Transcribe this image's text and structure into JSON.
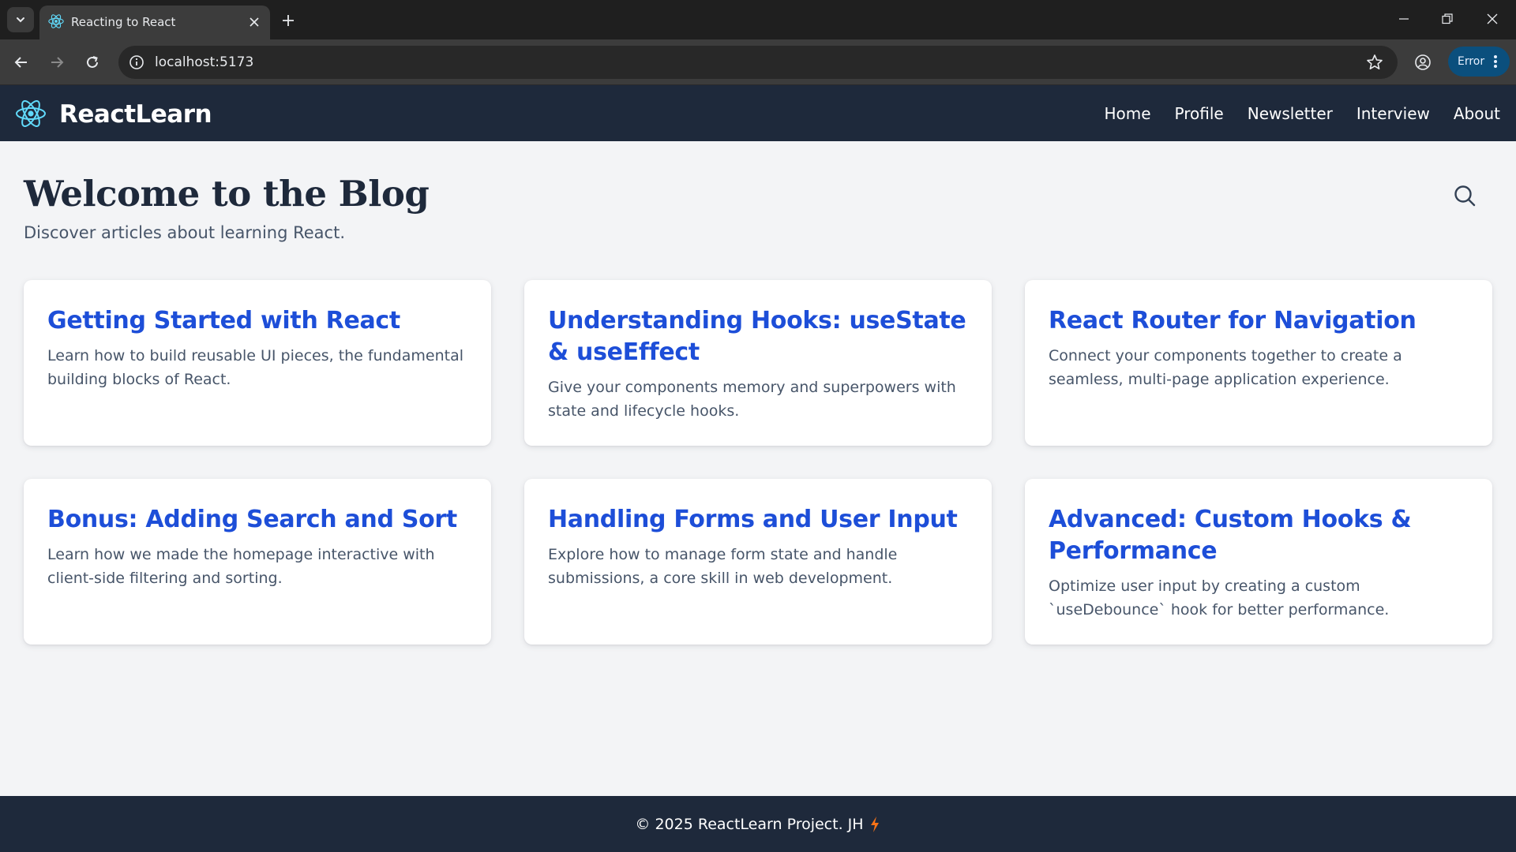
{
  "browser": {
    "tab_title": "Reacting to React",
    "url": "localhost:5173",
    "error_label": "Error"
  },
  "header": {
    "brand": "ReactLearn",
    "nav": [
      {
        "label": "Home"
      },
      {
        "label": "Profile"
      },
      {
        "label": "Newsletter"
      },
      {
        "label": "Interview"
      },
      {
        "label": "About"
      }
    ]
  },
  "main": {
    "title": "Welcome to the Blog",
    "subtitle": "Discover articles about learning React.",
    "search_icon": "search-icon",
    "posts": [
      {
        "title": "Getting Started with React",
        "description": "Learn how to build reusable UI pieces, the fundamental building blocks of React."
      },
      {
        "title": "Understanding Hooks: useState & useEffect",
        "description": "Give your components memory and superpowers with state and lifecycle hooks."
      },
      {
        "title": "React Router for Navigation",
        "description": "Connect your components together to create a seamless, multi-page application experience."
      },
      {
        "title": "Bonus: Adding Search and Sort",
        "description": "Learn how we made the homepage interactive with client-side filtering and sorting."
      },
      {
        "title": "Handling Forms and User Input",
        "description": "Explore how to manage form state and handle submissions, a core skill in web development."
      },
      {
        "title": "Advanced: Custom Hooks & Performance",
        "description": "Optimize user input by creating a custom `useDebounce` hook for better performance."
      }
    ]
  },
  "footer": {
    "text": "© 2025 ReactLearn Project. JH"
  },
  "colors": {
    "header_bg": "#1e293b",
    "page_bg": "#f3f4f6",
    "card_title": "#1d4ed8",
    "react_logo": "#61dafb",
    "bolt": "#f97316"
  }
}
